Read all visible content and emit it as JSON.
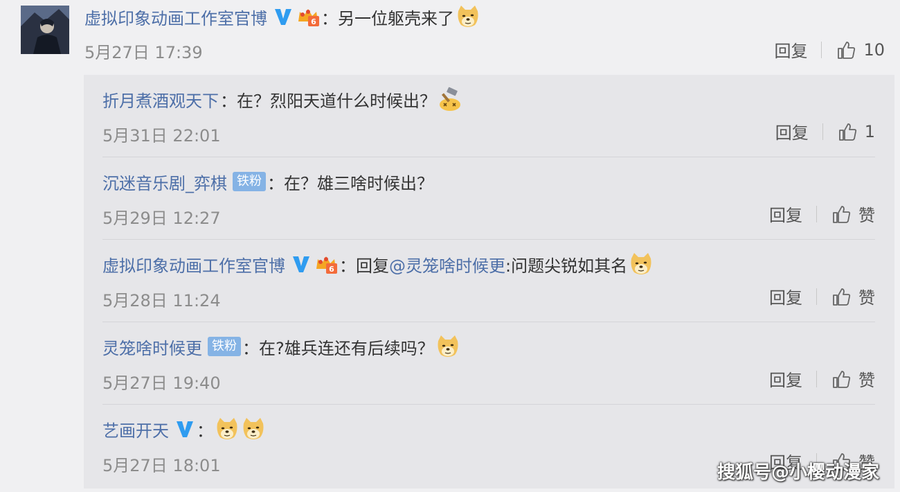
{
  "main": {
    "username": "虚拟印象动画工作室官博",
    "colon": "：",
    "text": "另一位躯壳来了",
    "date": "5月27日 17:39",
    "reply_label": "回复",
    "like_count": "10"
  },
  "replies": [
    {
      "username": "折月煮酒观天下",
      "badge": "",
      "colon": "：",
      "text": "在？烈阳天道什么时候出？",
      "mention": "",
      "text2": "",
      "date": "5月31日 22:01",
      "reply_label": "回复",
      "like_label": "1"
    },
    {
      "username": "沉迷音乐剧_弈棋",
      "badge": "铁粉",
      "colon": "：",
      "text": "在？雄三啥时候出？",
      "mention": "",
      "text2": "",
      "date": "5月29日 12:27",
      "reply_label": "回复",
      "like_label": "赞"
    },
    {
      "username": "虚拟印象动画工作室官博",
      "badge": "",
      "colon": "：",
      "text": "回复",
      "mention": "@灵笼啥时候更",
      "text2": ":问题尖锐如其名",
      "date": "5月28日 11:24",
      "reply_label": "回复",
      "like_label": "赞"
    },
    {
      "username": "灵笼啥时候更",
      "badge": "铁粉",
      "colon": "：",
      "text": "在?雄兵连还有后续吗？",
      "mention": "",
      "text2": "",
      "date": "5月27日 19:40",
      "reply_label": "回复",
      "like_label": "赞"
    },
    {
      "username": "艺画开天",
      "badge": "",
      "colon": "：",
      "text": "",
      "mention": "",
      "text2": "",
      "date": "5月27日 18:01",
      "reply_label": "回复",
      "like_label": "赞"
    }
  ],
  "watermark": "搜狐号@小樱动漫家",
  "colors": {
    "username": "#4d6fa8",
    "verified_blue": "#2f9cf0",
    "badge_bg": "#85b3e5",
    "reply_panel_bg": "#e6e6e9",
    "page_bg": "#f0f0f2"
  },
  "icons": [
    "verified-v-icon",
    "crown-vip-icon",
    "doge-emoji",
    "hammer-emoji",
    "thumb-up-icon"
  ]
}
